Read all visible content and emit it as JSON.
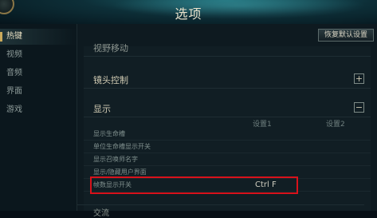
{
  "window": {
    "title": "选项"
  },
  "sidebar": {
    "items": [
      {
        "label": "热键",
        "active": true
      },
      {
        "label": "视频",
        "active": false
      },
      {
        "label": "音频",
        "active": false
      },
      {
        "label": "界面",
        "active": false
      },
      {
        "label": "游戏",
        "active": false
      }
    ]
  },
  "toolbar": {
    "restore_label": "恢复默认设置"
  },
  "sections": {
    "partial_top": "视野移动",
    "camera": {
      "label": "镜头控制",
      "toggle": "+"
    },
    "display": {
      "label": "显示",
      "toggle": "−"
    },
    "partial_bottom": "交流"
  },
  "columns": [
    "设置1",
    "设置2"
  ],
  "rows": [
    {
      "label": "显示生命槽",
      "setting1": "",
      "setting2": ""
    },
    {
      "label": "单位生命槽显示开关",
      "setting1": "",
      "setting2": ""
    },
    {
      "label": "显示召唤师名字",
      "setting1": "",
      "setting2": ""
    },
    {
      "label": "显示/隐藏用户界面",
      "setting1": "",
      "setting2": ""
    },
    {
      "label": "帧数显示开关",
      "setting1": "Ctrl  F",
      "setting2": ""
    }
  ],
  "colors": {
    "highlight": "#d8121b",
    "accent": "#c9a95b"
  }
}
